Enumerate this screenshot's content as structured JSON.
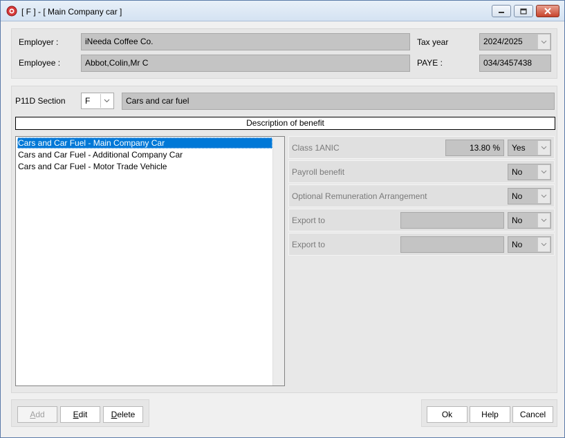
{
  "window": {
    "title": "[ F ] - [ Main Company car ]"
  },
  "header": {
    "employer_label": "Employer :",
    "employer_value": "iNeeda Coffee Co.",
    "employee_label": "Employee :",
    "employee_value": "Abbot,Colin,Mr C",
    "tax_year_label": "Tax year",
    "tax_year_value": "2024/2025",
    "paye_label": "PAYE :",
    "paye_value": "034/3457438"
  },
  "section": {
    "label": "P11D Section",
    "code": "F",
    "description": "Cars and car fuel",
    "benefit_header": "Description of benefit"
  },
  "benefits": [
    {
      "label": "Cars and Car Fuel - Main Company Car",
      "selected": true
    },
    {
      "label": "Cars and Car Fuel - Additional Company Car",
      "selected": false
    },
    {
      "label": "Cars and Car Fuel - Motor Trade Vehicle",
      "selected": false
    }
  ],
  "properties": {
    "class1a_label": "Class 1ANIC",
    "class1a_rate": "13.80 %",
    "class1a_choice": "Yes",
    "payroll_label": "Payroll benefit",
    "payroll_choice": "No",
    "ora_label": "Optional Remuneration Arrangement",
    "ora_choice": "No",
    "export1_label": "Export to",
    "export1_value": "",
    "export1_choice": "No",
    "export2_label": "Export to",
    "export2_value": "",
    "export2_choice": "No"
  },
  "buttons": {
    "add_pre": "",
    "add_ul": "A",
    "add_post": "dd",
    "edit_ul": "E",
    "edit_post": "dit",
    "delete_ul": "D",
    "delete_post": "elete",
    "ok": "Ok",
    "help": "Help",
    "cancel": "Cancel"
  },
  "colors": {
    "selection": "#0078d7",
    "readonly_field": "#c4c4c4",
    "close_button": "#c8442c"
  },
  "icons": [
    "app-icon",
    "minimize-icon",
    "maximize-icon",
    "close-icon",
    "chevron-down-icon"
  ]
}
